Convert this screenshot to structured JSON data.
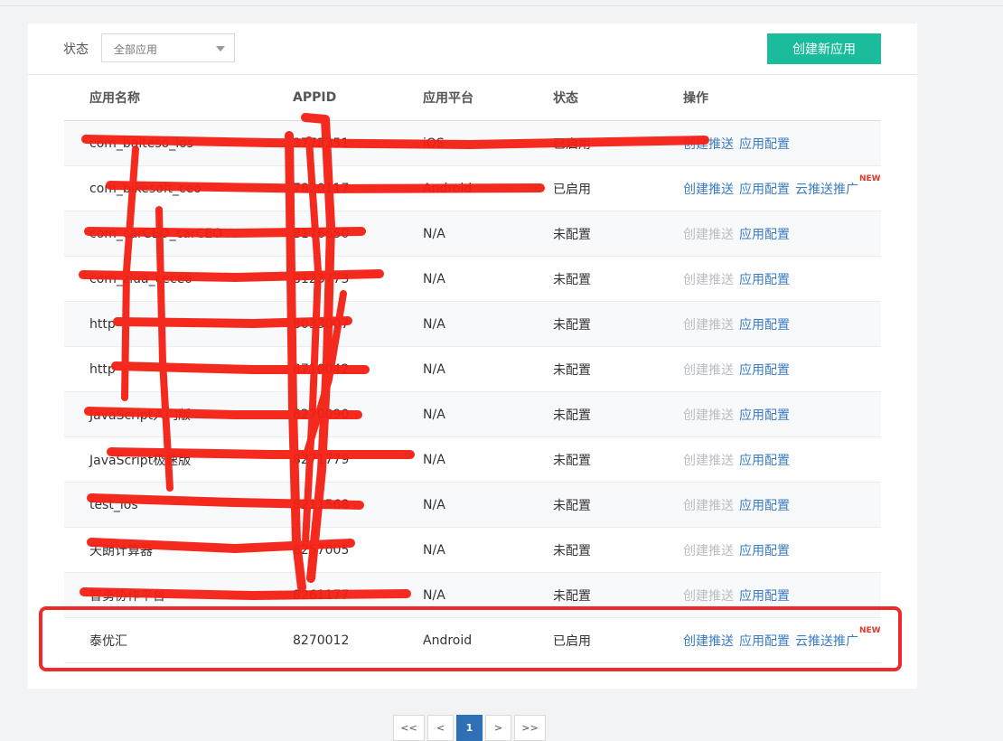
{
  "filter": {
    "label": "状态",
    "selected": "全部应用"
  },
  "create_button": "创建新应用",
  "columns": [
    "应用名称",
    "APPID",
    "应用平台",
    "状态",
    "操作"
  ],
  "rows": [
    {
      "name": "com_baiteso_ios",
      "appid": "3773351",
      "platform": "iOS",
      "status": "已启用",
      "actions": [
        {
          "label": "创建推送",
          "enabled": true
        },
        {
          "label": "应用配置",
          "enabled": true
        }
      ],
      "has_cloud": false
    },
    {
      "name": "com_bikesoft_ceo",
      "appid": "7820117",
      "platform": "Android",
      "status": "已启用",
      "actions": [
        {
          "label": "创建推送",
          "enabled": true
        },
        {
          "label": "应用配置",
          "enabled": true
        },
        {
          "label": "云推送推广",
          "enabled": true
        }
      ],
      "has_cloud": true
    },
    {
      "name": "com_carCEO_carCEO",
      "appid": "8176650",
      "platform": "N/A",
      "status": "未配置",
      "actions": [
        {
          "label": "创建推送",
          "enabled": false
        },
        {
          "label": "应用配置",
          "enabled": true
        }
      ],
      "has_cloud": false
    },
    {
      "name": "com_ziua_ceceo",
      "appid": "8123773",
      "platform": "N/A",
      "status": "未配置",
      "actions": [
        {
          "label": "创建推送",
          "enabled": false
        },
        {
          "label": "应用配置",
          "enabled": true
        }
      ],
      "has_cloud": false
    },
    {
      "name": "http",
      "appid": "8033007",
      "platform": "N/A",
      "status": "未配置",
      "actions": [
        {
          "label": "创建推送",
          "enabled": false
        },
        {
          "label": "应用配置",
          "enabled": true
        }
      ],
      "has_cloud": false
    },
    {
      "name": "http",
      "appid": "8710042",
      "platform": "N/A",
      "status": "未配置",
      "actions": [
        {
          "label": "创建推送",
          "enabled": false
        },
        {
          "label": "应用配置",
          "enabled": true
        }
      ],
      "has_cloud": false
    },
    {
      "name": "JavaScript入门版",
      "appid": "8270090",
      "platform": "N/A",
      "status": "未配置",
      "actions": [
        {
          "label": "创建推送",
          "enabled": false
        },
        {
          "label": "应用配置",
          "enabled": true
        }
      ],
      "has_cloud": false
    },
    {
      "name": "JavaScript极速版",
      "appid": "8271779",
      "platform": "N/A",
      "status": "未配置",
      "actions": [
        {
          "label": "创建推送",
          "enabled": false
        },
        {
          "label": "应用配置",
          "enabled": true
        }
      ],
      "has_cloud": false
    },
    {
      "name": "test_ios",
      "appid": "8211568",
      "platform": "N/A",
      "status": "未配置",
      "actions": [
        {
          "label": "创建推送",
          "enabled": false
        },
        {
          "label": "应用配置",
          "enabled": true
        }
      ],
      "has_cloud": false
    },
    {
      "name": "天朗计算器",
      "appid": "8257005",
      "platform": "N/A",
      "status": "未配置",
      "actions": [
        {
          "label": "创建推送",
          "enabled": false
        },
        {
          "label": "应用配置",
          "enabled": true
        }
      ],
      "has_cloud": false
    },
    {
      "name": "智勇协作平台",
      "appid": "8261177",
      "platform": "N/A",
      "status": "未配置",
      "actions": [
        {
          "label": "创建推送",
          "enabled": false
        },
        {
          "label": "应用配置",
          "enabled": true
        }
      ],
      "has_cloud": false
    },
    {
      "name": "泰优汇",
      "appid": "8270012",
      "platform": "Android",
      "status": "已启用",
      "actions": [
        {
          "label": "创建推送",
          "enabled": true
        },
        {
          "label": "应用配置",
          "enabled": true
        },
        {
          "label": "云推送推广",
          "enabled": true
        }
      ],
      "has_cloud": true
    }
  ],
  "new_badge": "NEW",
  "pagination": {
    "first": "<<",
    "prev": "<",
    "current": "1",
    "next": ">",
    "last": ">>"
  },
  "colors": {
    "accent": "#1abc9c",
    "link": "#3a7cc1",
    "disabled": "#b9bec5",
    "highlight": "#ee2b2b",
    "scribble": "#f41f14",
    "page_active": "#2e6fb5"
  }
}
